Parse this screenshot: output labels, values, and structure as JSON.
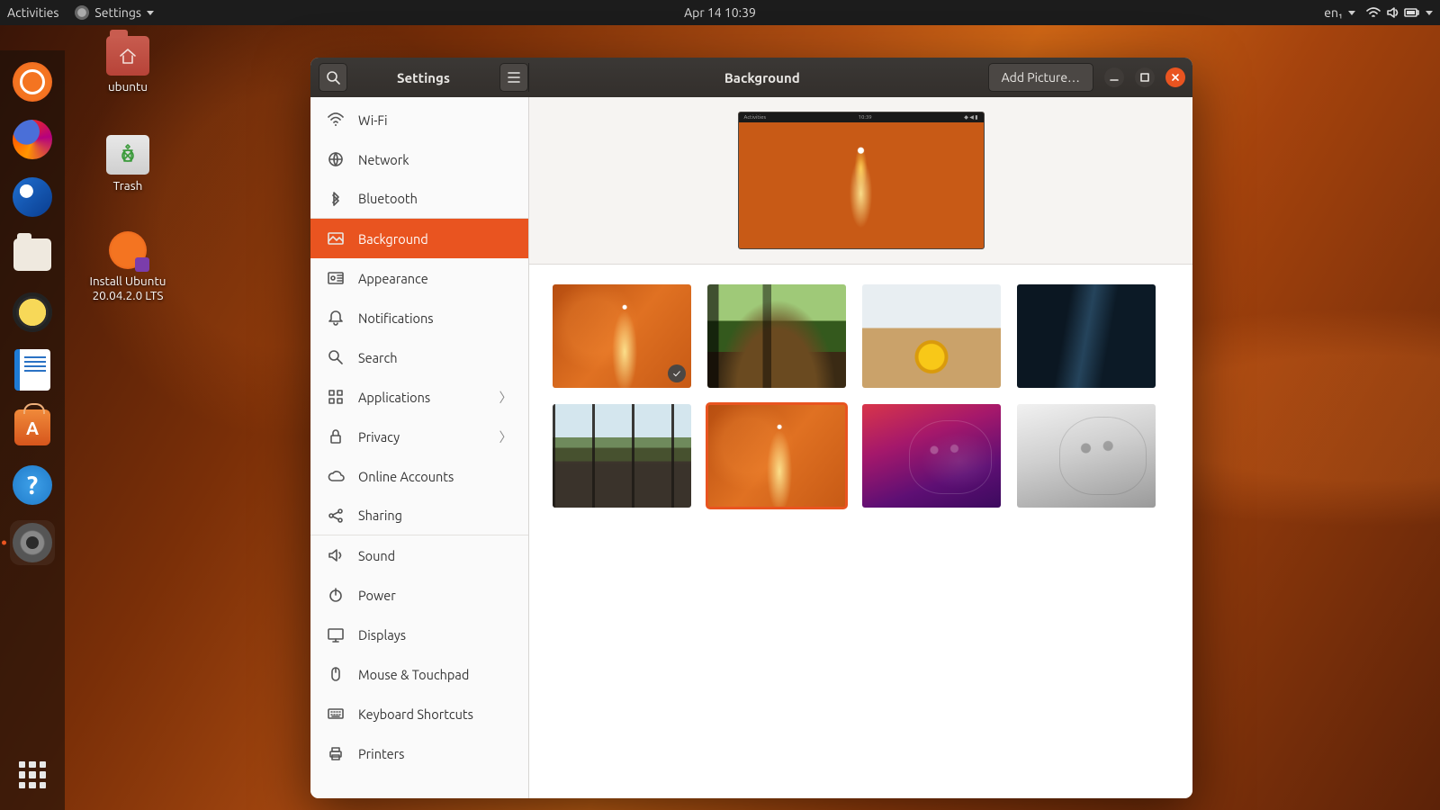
{
  "panel": {
    "activities": "Activities",
    "app_menu": "Settings",
    "clock": "Apr 14  10:39",
    "input_source": "en₁"
  },
  "desktop_icons": {
    "home": "ubuntu",
    "trash": "Trash",
    "installer_line1": "Install Ubuntu",
    "installer_line2": "20.04.2.0 LTS"
  },
  "window": {
    "app_title": "Settings",
    "page_title": "Background",
    "add_picture": "Add Picture…",
    "preview_bar": {
      "left": "Activities",
      "center": "10:39"
    }
  },
  "sidebar": [
    {
      "id": "wifi",
      "label": "Wi-Fi",
      "icon": "wifi",
      "chevron": false,
      "sep": false,
      "selected": false
    },
    {
      "id": "network",
      "label": "Network",
      "icon": "network",
      "chevron": false,
      "sep": false,
      "selected": false
    },
    {
      "id": "bluetooth",
      "label": "Bluetooth",
      "icon": "bluetooth",
      "chevron": false,
      "sep": true,
      "selected": false
    },
    {
      "id": "background",
      "label": "Background",
      "icon": "background",
      "chevron": false,
      "sep": false,
      "selected": true
    },
    {
      "id": "appearance",
      "label": "Appearance",
      "icon": "appearance",
      "chevron": false,
      "sep": false,
      "selected": false
    },
    {
      "id": "notifications",
      "label": "Notifications",
      "icon": "bell",
      "chevron": false,
      "sep": false,
      "selected": false
    },
    {
      "id": "search",
      "label": "Search",
      "icon": "search",
      "chevron": false,
      "sep": false,
      "selected": false
    },
    {
      "id": "applications",
      "label": "Applications",
      "icon": "apps",
      "chevron": true,
      "sep": false,
      "selected": false
    },
    {
      "id": "privacy",
      "label": "Privacy",
      "icon": "lock",
      "chevron": true,
      "sep": false,
      "selected": false
    },
    {
      "id": "online",
      "label": "Online Accounts",
      "icon": "cloud",
      "chevron": false,
      "sep": false,
      "selected": false
    },
    {
      "id": "sharing",
      "label": "Sharing",
      "icon": "share",
      "chevron": false,
      "sep": true,
      "selected": false
    },
    {
      "id": "sound",
      "label": "Sound",
      "icon": "sound",
      "chevron": false,
      "sep": false,
      "selected": false
    },
    {
      "id": "power",
      "label": "Power",
      "icon": "power",
      "chevron": false,
      "sep": false,
      "selected": false
    },
    {
      "id": "displays",
      "label": "Displays",
      "icon": "display",
      "chevron": false,
      "sep": false,
      "selected": false
    },
    {
      "id": "mouse",
      "label": "Mouse & Touchpad",
      "icon": "mouse",
      "chevron": false,
      "sep": false,
      "selected": false
    },
    {
      "id": "keyboard",
      "label": "Keyboard Shortcuts",
      "icon": "keyboard",
      "chevron": false,
      "sep": false,
      "selected": false
    },
    {
      "id": "printers",
      "label": "Printers",
      "icon": "printer",
      "chevron": false,
      "sep": false,
      "selected": false
    }
  ],
  "wallpapers": [
    {
      "id": "default",
      "style": "wp-default",
      "selected_grid": false,
      "checked": true
    },
    {
      "id": "forest",
      "style": "wp-forest",
      "selected_grid": false,
      "checked": false
    },
    {
      "id": "desk",
      "style": "wp-desk",
      "selected_grid": false,
      "checked": false
    },
    {
      "id": "subway",
      "style": "wp-subway",
      "selected_grid": false,
      "checked": false
    },
    {
      "id": "bridge",
      "style": "wp-bridge",
      "selected_grid": false,
      "checked": false
    },
    {
      "id": "default2",
      "style": "wp-default",
      "selected_grid": true,
      "checked": false
    },
    {
      "id": "cat-purple",
      "style": "wp-cat-purple",
      "selected_grid": false,
      "checked": false
    },
    {
      "id": "cat-grey",
      "style": "wp-cat-grey",
      "selected_grid": false,
      "checked": false
    }
  ]
}
